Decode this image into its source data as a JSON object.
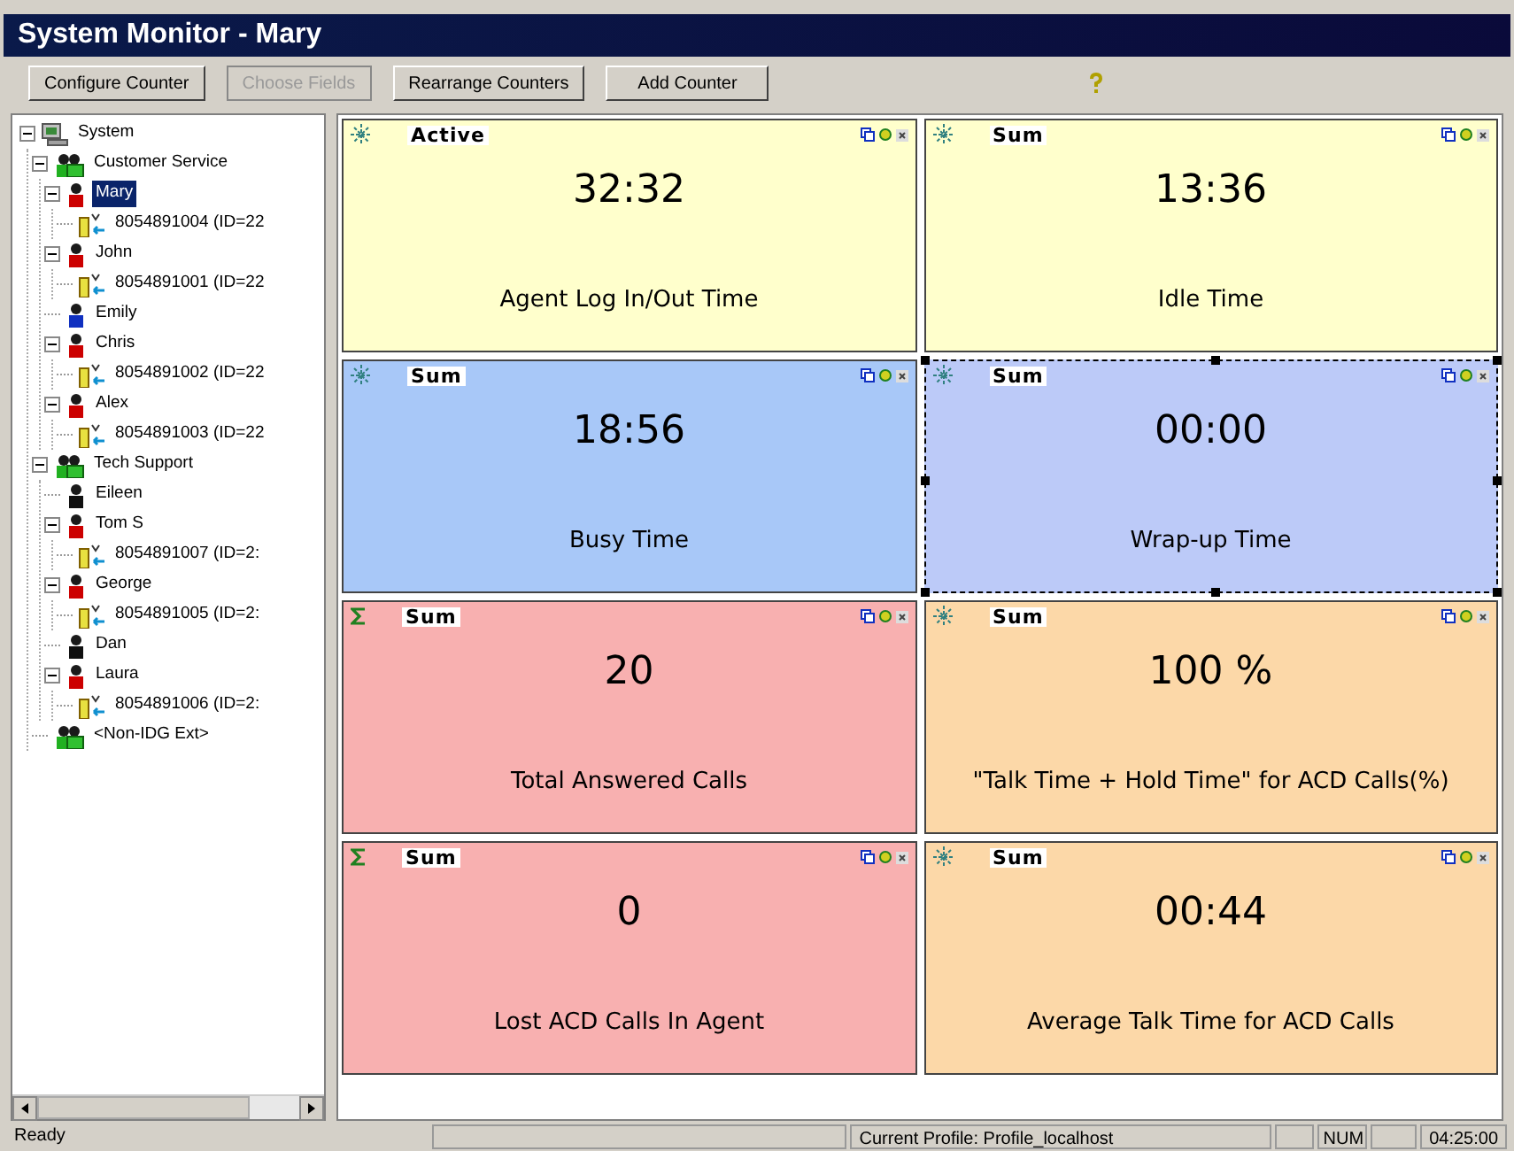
{
  "window": {
    "title": "System Monitor - Mary"
  },
  "toolbar": {
    "buttons": [
      {
        "label": "Configure Counter",
        "disabled": false
      },
      {
        "label": "Choose Fields",
        "disabled": true
      },
      {
        "label": "Rearrange Counters",
        "disabled": false
      },
      {
        "label": "Add Counter",
        "disabled": false
      }
    ]
  },
  "tree": [
    {
      "label": "System",
      "kind": "system",
      "expanded": true,
      "selected": false,
      "children": [
        {
          "label": "Customer Service",
          "kind": "group",
          "expanded": true,
          "selected": false,
          "children": [
            {
              "label": "Mary",
              "kind": "agent",
              "color": "#cc0000",
              "expanded": true,
              "selected": true,
              "children": [
                {
                  "label": "8054891004 (ID=22",
                  "kind": "extension",
                  "selected": false
                }
              ]
            },
            {
              "label": "John",
              "kind": "agent",
              "color": "#cc0000",
              "expanded": true,
              "selected": false,
              "children": [
                {
                  "label": "8054891001 (ID=22",
                  "kind": "extension",
                  "selected": false
                }
              ]
            },
            {
              "label": "Emily",
              "kind": "agent",
              "color": "#1030c0",
              "selected": false
            },
            {
              "label": "Chris",
              "kind": "agent",
              "color": "#cc0000",
              "expanded": true,
              "selected": false,
              "children": [
                {
                  "label": "8054891002 (ID=22",
                  "kind": "extension",
                  "selected": false
                }
              ]
            },
            {
              "label": "Alex",
              "kind": "agent",
              "color": "#cc0000",
              "expanded": true,
              "selected": false,
              "children": [
                {
                  "label": "8054891003 (ID=22",
                  "kind": "extension",
                  "selected": false
                }
              ]
            }
          ]
        },
        {
          "label": "Tech Support",
          "kind": "group",
          "expanded": true,
          "selected": false,
          "children": [
            {
              "label": "Eileen",
              "kind": "agent",
              "color": "#101010",
              "selected": false
            },
            {
              "label": "Tom S",
              "kind": "agent",
              "color": "#cc0000",
              "expanded": true,
              "selected": false,
              "children": [
                {
                  "label": "8054891007 (ID=2:",
                  "kind": "extension",
                  "selected": false
                }
              ]
            },
            {
              "label": "George",
              "kind": "agent",
              "color": "#cc0000",
              "expanded": true,
              "selected": false,
              "children": [
                {
                  "label": "8054891005 (ID=2:",
                  "kind": "extension",
                  "selected": false
                }
              ]
            },
            {
              "label": "Dan",
              "kind": "agent",
              "color": "#101010",
              "selected": false
            },
            {
              "label": "Laura",
              "kind": "agent",
              "color": "#cc0000",
              "expanded": true,
              "selected": false,
              "children": [
                {
                  "label": "8054891006 (ID=2:",
                  "kind": "extension",
                  "selected": false
                }
              ]
            }
          ]
        },
        {
          "label": "<Non-IDG Ext>",
          "kind": "group",
          "selected": false
        }
      ]
    }
  ],
  "counters": [
    {
      "mode": "Active",
      "kind": "burst",
      "value": "32:32",
      "name": "Agent Log In/Out Time",
      "color": "#ffffcc",
      "selected": false
    },
    {
      "mode": "Sum",
      "kind": "burst",
      "value": "13:36",
      "name": "Idle Time",
      "color": "#ffffcc",
      "selected": false
    },
    {
      "mode": "Sum",
      "kind": "burst",
      "value": "18:56",
      "name": "Busy Time",
      "color": "#a8c8f8",
      "selected": false
    },
    {
      "mode": "Sum",
      "kind": "burst",
      "value": "00:00",
      "name": "Wrap-up Time",
      "color": "#bccaf8",
      "selected": true
    },
    {
      "mode": "Sum",
      "kind": "sigma",
      "value": "20",
      "name": "Total Answered Calls",
      "color": "#f8b0b0",
      "selected": false
    },
    {
      "mode": "Sum",
      "kind": "burst",
      "value": "100 %",
      "name": "\"Talk Time + Hold Time\" for ACD Calls(%)",
      "color": "#fcd8a8",
      "selected": false
    },
    {
      "mode": "Sum",
      "kind": "sigma",
      "value": "0",
      "name": "Lost ACD Calls In Agent",
      "color": "#f8b0b0",
      "selected": false
    },
    {
      "mode": "Sum",
      "kind": "burst",
      "value": "00:44",
      "name": "Average Talk Time for ACD Calls",
      "color": "#fcd8a8",
      "selected": false
    }
  ],
  "status_bar": {
    "message": "Ready",
    "profile": "Current Profile: Profile_localhost",
    "num": "NUM",
    "time": "04:25:00"
  }
}
